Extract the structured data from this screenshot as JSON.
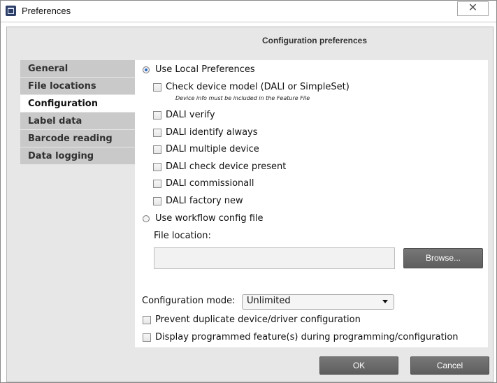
{
  "window": {
    "title": "Preferences",
    "close_glyph": "✕"
  },
  "header": {
    "title": "Configuration preferences"
  },
  "sidebar": {
    "items": [
      {
        "label": "General"
      },
      {
        "label": "File locations"
      },
      {
        "label": "Configuration"
      },
      {
        "label": "Label data"
      },
      {
        "label": "Barcode reading"
      },
      {
        "label": "Data logging"
      }
    ],
    "selected": "Configuration"
  },
  "options": {
    "local_prefs": "Use Local Preferences",
    "check_model": "Check device model (DALI or SimpleSet)",
    "check_model_note": "Device info must be included in the Feature File",
    "dali_verify": "DALI verify",
    "dali_identify": "DALI identify always",
    "dali_multiple": "DALI multiple device",
    "dali_present": "DALI check device present",
    "dali_commission": "DALI commissionall",
    "dali_factory": "DALI factory new",
    "workflow": "Use workflow config file",
    "file_location_label": "File location:",
    "file_location_value": "",
    "browse": "Browse...",
    "mode_label": "Configuration mode:",
    "mode_value": "Unlimited",
    "prevent_duplicate": "Prevent duplicate device/driver configuration",
    "display_programmed": "Display programmed feature(s) during programming/configuration"
  },
  "footer": {
    "ok": "OK",
    "cancel": "Cancel"
  },
  "colors": {
    "selected_radio": "#2e68c9",
    "nav_inactive": "#c9c9c9",
    "button": "#6a6a6a"
  }
}
